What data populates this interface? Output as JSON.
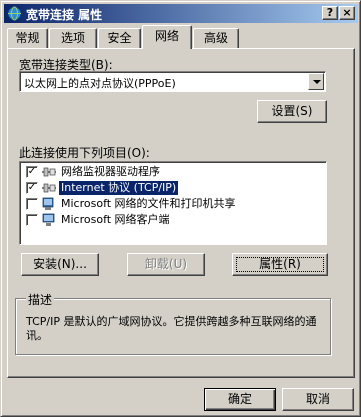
{
  "window": {
    "title": "宽带连接 属性",
    "help_glyph": "?",
    "close_glyph": "×"
  },
  "tabs": [
    {
      "label": "常规"
    },
    {
      "label": "选项"
    },
    {
      "label": "安全"
    },
    {
      "label": "网络",
      "active": true
    },
    {
      "label": "高级"
    }
  ],
  "network": {
    "type_label": "宽带连接类型(B):",
    "type_value": "以太网上的点对点协议(PPPoE)",
    "settings_button": "设置(S)",
    "items_label": "此连接使用下列项目(O):",
    "items": [
      {
        "label": "网络监视器驱动程序",
        "checked": true,
        "selected": false,
        "icon": "network-monitor-icon"
      },
      {
        "label": "Internet 协议 (TCP/IP)",
        "checked": true,
        "selected": true,
        "icon": "protocol-icon"
      },
      {
        "label": "Microsoft 网络的文件和打印机共享",
        "checked": false,
        "selected": false,
        "icon": "file-printer-sharing-icon"
      },
      {
        "label": "Microsoft 网络客户端",
        "checked": false,
        "selected": false,
        "icon": "network-client-icon"
      }
    ],
    "install_button": "安装(N)...",
    "uninstall_button": "卸载(U)",
    "properties_button": "属性(R)",
    "description_title": "描述",
    "description_text": "TCP/IP 是默认的广域网协议。它提供跨越多种互联网络的通讯。"
  },
  "footer": {
    "ok_button": "确定",
    "cancel_button": "取消"
  },
  "colors": {
    "face": "#d4d0c8",
    "title_start": "#0a246a",
    "title_end": "#a6caf0",
    "selection": "#0a246a"
  }
}
